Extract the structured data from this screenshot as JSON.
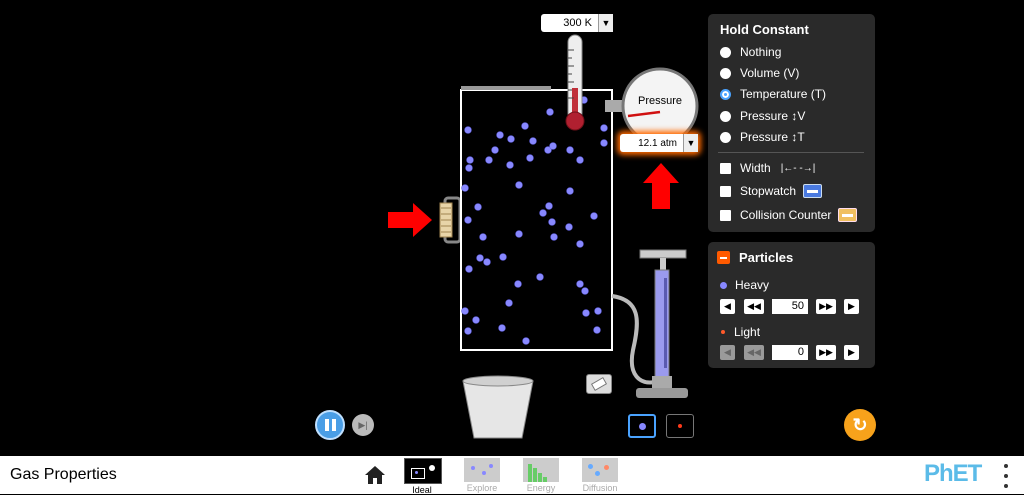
{
  "app": {
    "title": "Gas Properties"
  },
  "thermometer": {
    "value": "300 K",
    "dropdown_glyph": "▼"
  },
  "gauge": {
    "label": "Pressure",
    "value": "12.1 atm",
    "dropdown_glyph": "▼"
  },
  "hold_constant": {
    "title": "Hold Constant",
    "options": [
      {
        "label": "Nothing",
        "selected": false
      },
      {
        "label": "Volume (V)",
        "selected": false
      },
      {
        "label": "Temperature (T)",
        "selected": true
      },
      {
        "label": "Pressure ↕V",
        "selected": false
      },
      {
        "label": "Pressure ↕T",
        "selected": false
      }
    ],
    "tools": [
      {
        "label": "Width",
        "icon": "width-ruler-icon",
        "checked": false
      },
      {
        "label": "Stopwatch",
        "icon": "stopwatch-icon",
        "checked": false
      },
      {
        "label": "Collision Counter",
        "icon": "collision-counter-icon",
        "checked": false
      }
    ]
  },
  "particles": {
    "title": "Particles",
    "heavy": {
      "label": "Heavy",
      "count": "50",
      "color": "#8888ff"
    },
    "light": {
      "label": "Light",
      "count": "0",
      "color": "#ff5a2a"
    }
  },
  "nav": {
    "screens": [
      {
        "label": "Ideal",
        "active": true
      },
      {
        "label": "Explore",
        "active": false
      },
      {
        "label": "Energy",
        "active": false
      },
      {
        "label": "Diffusion",
        "active": false
      }
    ],
    "logo": "PhET"
  },
  "colors": {
    "accent_orange": "#ff6a00",
    "heavy_particle": "#8888ff",
    "light_particle": "#ff5a2a",
    "arrow_red": "#ff0000"
  }
}
